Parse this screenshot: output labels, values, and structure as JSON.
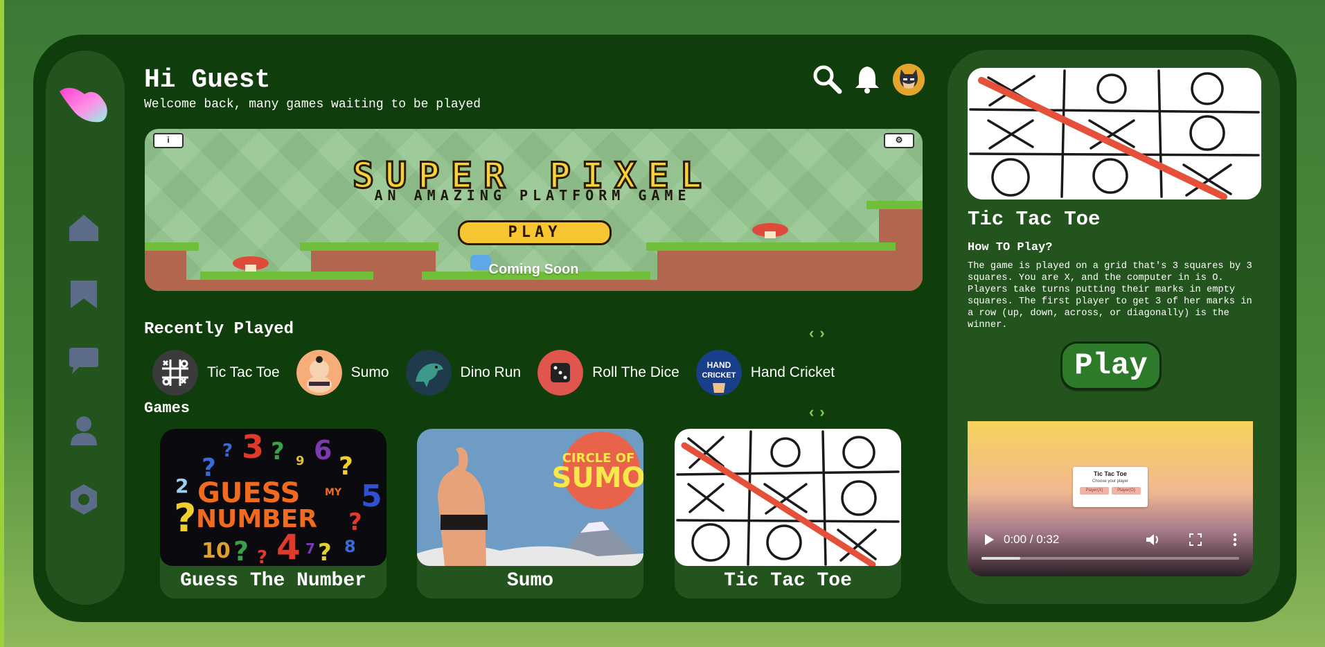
{
  "header": {
    "greeting": "Hi Guest",
    "welcome": "Welcome back, many games waiting to be played"
  },
  "banner": {
    "title": "SUPER PIXEL",
    "subtitle": "AN AMAZING PLATFORM GAME",
    "play_label": "PLAY",
    "status": "Coming Soon",
    "info_label": "i",
    "settings_label": "⚙"
  },
  "sidebar": {
    "items": [
      "home-icon",
      "bookmark-icon",
      "chat-icon",
      "user-icon",
      "settings-icon"
    ]
  },
  "recent": {
    "title": "Recently Played",
    "items": [
      {
        "label": "Tic Tac Toe"
      },
      {
        "label": "Sumo"
      },
      {
        "label": "Dino Run"
      },
      {
        "label": "Roll The Dice"
      },
      {
        "label": "Hand Cricket"
      }
    ]
  },
  "games": {
    "title": "Games",
    "cards": [
      {
        "label": "Guess The Number",
        "art_text_1": "GUESS",
        "art_text_2": "MY",
        "art_text_3": "NUMBER"
      },
      {
        "label": "Sumo",
        "art_text_1": "CIRCLE OF",
        "art_text_2": "SUMO"
      },
      {
        "label": "Tic Tac Toe"
      }
    ]
  },
  "detail": {
    "title": "Tic Tac Toe",
    "howto_heading": "How TO Play?",
    "description": "The game is played on a grid that's 3 squares by 3 squares. You are X, and the computer in is O. Players take turns putting their marks in empty squares. The first player to get 3 of her marks in a row (up, down, across, or diagonally) is the winner.",
    "play_label": "Play"
  },
  "video": {
    "time": "0:00 / 0:32",
    "progress": 0.15,
    "preview_title": "Tic Tac Toe",
    "preview_sub": "Choose your player",
    "preview_btn_1": "Player(X)",
    "preview_btn_2": "Player(O)"
  },
  "hand_cricket_badge": {
    "line1": "HAND",
    "line2": "CRICKET"
  },
  "colors": {
    "accent": "#7ed04b",
    "frame": "#103d0c",
    "panel": "#24541e",
    "icon": "#5b6b88"
  }
}
